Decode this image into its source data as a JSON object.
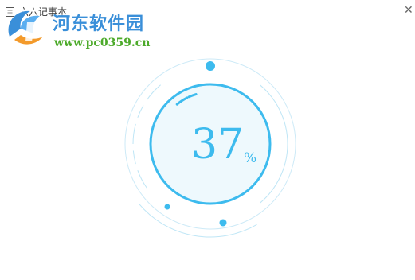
{
  "window": {
    "title": "六六记事本",
    "close_glyph": "✕"
  },
  "watermark": {
    "site_name": "河东软件园",
    "url": "www.pc0359.cn"
  },
  "progress": {
    "value_text": "37",
    "unit": "%",
    "fraction": 0.37
  },
  "colors": {
    "accent": "#3dbbee",
    "ring_light": "#bfe6f6",
    "disc_fill": "#eef9fd",
    "watermark_blue": "#3a8fd9",
    "watermark_green": "#4caa2a",
    "watermark_orange": "#f39a2b"
  },
  "icons": {
    "app": "notebook-icon",
    "close": "close-icon",
    "logo": "watermark-logo-icon"
  }
}
